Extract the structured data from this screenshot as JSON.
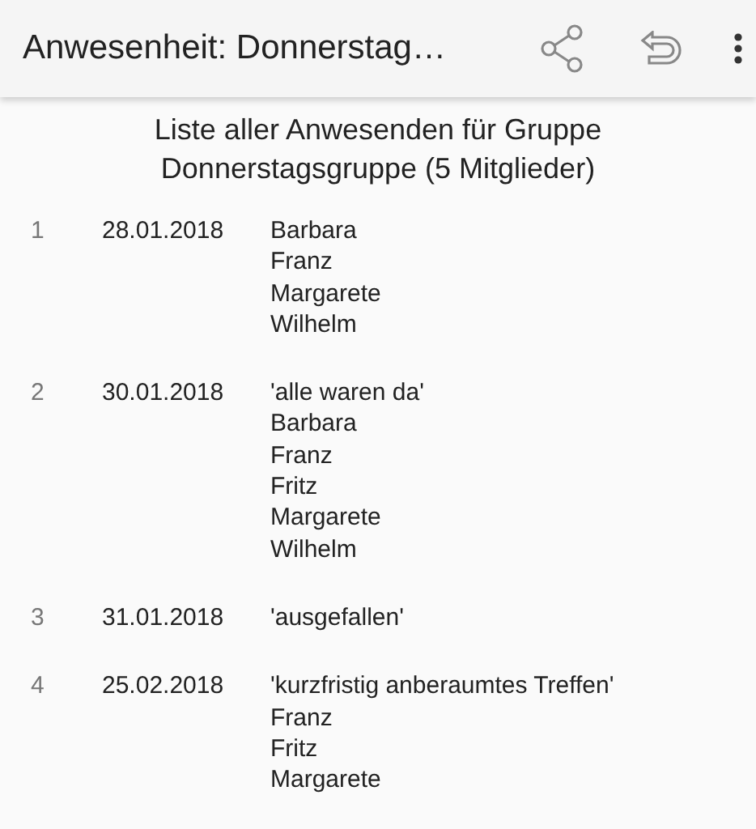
{
  "app_bar": {
    "title": "Anwesenheit: Donnerstag…"
  },
  "heading": [
    "Liste aller Anwesenden für Gruppe",
    "Donnerstagsgruppe (5 Mitglieder)"
  ],
  "entries": [
    {
      "number": "1",
      "date": "28.01.2018",
      "members": [
        "Barbara",
        "Franz",
        "Margarete",
        "Wilhelm"
      ]
    },
    {
      "number": "2",
      "date": "30.01.2018",
      "note": "'alle waren da'",
      "members": [
        "Barbara",
        "Franz",
        "Fritz",
        "Margarete",
        "Wilhelm"
      ]
    },
    {
      "number": "3",
      "date": "31.01.2018",
      "note": "'ausgefallen'"
    },
    {
      "number": "4",
      "date": "25.02.2018",
      "note": "'kurzfristig anberaumtes Treffen'",
      "members": [
        "Franz",
        "Fritz",
        "Margarete"
      ]
    }
  ]
}
